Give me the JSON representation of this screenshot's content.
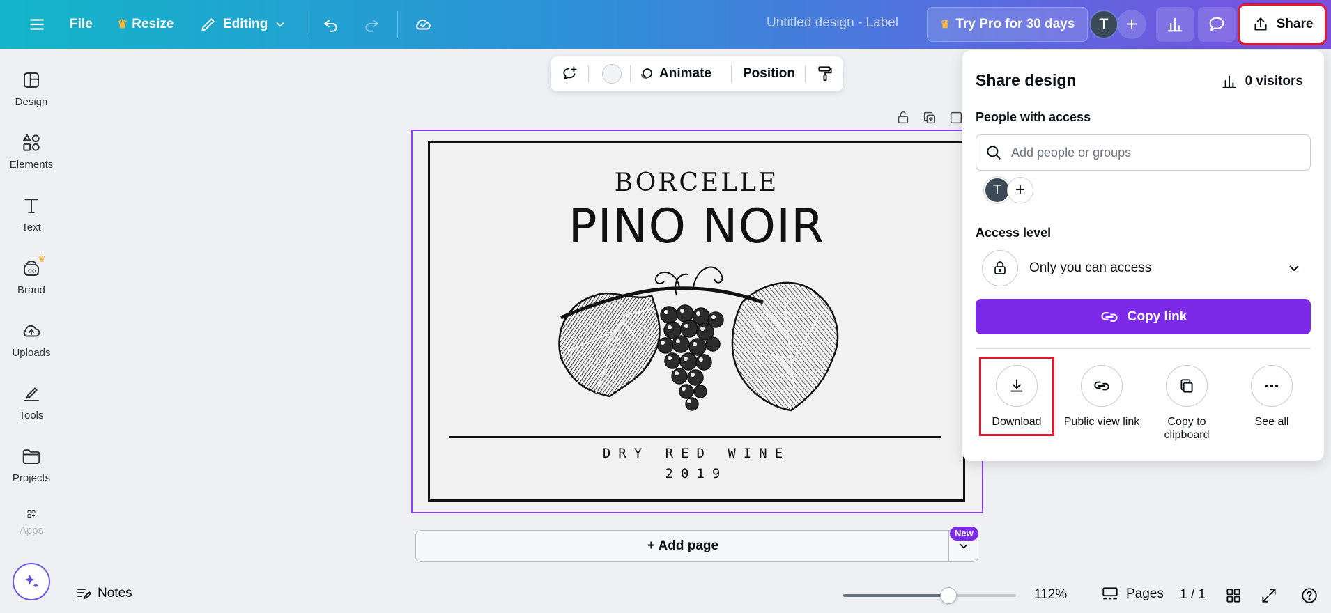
{
  "topbar": {
    "file_label": "File",
    "resize_label": "Resize",
    "editing_label": "Editing",
    "doc_title": "Untitled design - Label",
    "try_pro_label": "Try Pro for 30 days",
    "avatar_initial": "T",
    "share_label": "Share"
  },
  "sidebar": {
    "items": [
      {
        "label": "Design",
        "icon": "design-icon"
      },
      {
        "label": "Elements",
        "icon": "elements-icon"
      },
      {
        "label": "Text",
        "icon": "text-icon"
      },
      {
        "label": "Brand",
        "icon": "brand-icon"
      },
      {
        "label": "Uploads",
        "icon": "uploads-icon"
      },
      {
        "label": "Tools",
        "icon": "tools-icon"
      },
      {
        "label": "Projects",
        "icon": "projects-icon"
      },
      {
        "label": "Apps",
        "icon": "apps-icon"
      }
    ]
  },
  "context_toolbar": {
    "animate_label": "Animate",
    "position_label": "Position"
  },
  "label_design": {
    "brand": "BORCELLE",
    "product": "PINO NOIR",
    "wine_type": "DRY RED WINE",
    "year": "2019"
  },
  "canvas": {
    "add_page_label": "+ Add page",
    "new_badge": "New"
  },
  "bottombar": {
    "notes_label": "Notes",
    "zoom_value": "112%",
    "zoom_fraction": 0.61,
    "pages_label": "Pages",
    "page_count": "1 / 1"
  },
  "share_panel": {
    "title": "Share design",
    "visitors_label": "0 visitors",
    "people_label": "People with access",
    "search_placeholder": "Add people or groups",
    "member_initial": "T",
    "access_level_label": "Access level",
    "access_value": "Only you can access",
    "copy_link_label": "Copy link",
    "actions": [
      {
        "label": "Download",
        "icon": "download-icon"
      },
      {
        "label": "Public view link",
        "icon": "link-icon"
      },
      {
        "label": "Copy to clipboard",
        "icon": "clipboard-icon"
      },
      {
        "label": "See all",
        "icon": "more-icon"
      }
    ]
  },
  "colors": {
    "accent_purple": "#7d2ae8",
    "highlight_red": "#e0192f",
    "topbar_start": "#13b5c9",
    "topbar_end": "#7b4fe0"
  }
}
